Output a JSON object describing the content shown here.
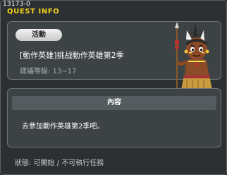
{
  "window": {
    "quest_id": "13173-0",
    "title": "QUEST INFO",
    "close_symbol": "×"
  },
  "quest": {
    "category_badge": "活動",
    "name": "[動作英雄]挑战動作英雄第2季",
    "level_text": "建議等級: 13~17"
  },
  "npc": {
    "portrait_icon": "tribal-warrior-npc-icon"
  },
  "content": {
    "header": "內容",
    "text": "去參加動作英雄第2季吧。"
  },
  "status": {
    "text": "狀態: 可開始 / 不可執行任務"
  },
  "colors": {
    "title": "#f2d21c",
    "panel": "#3d4245",
    "background": "#2c3033"
  }
}
